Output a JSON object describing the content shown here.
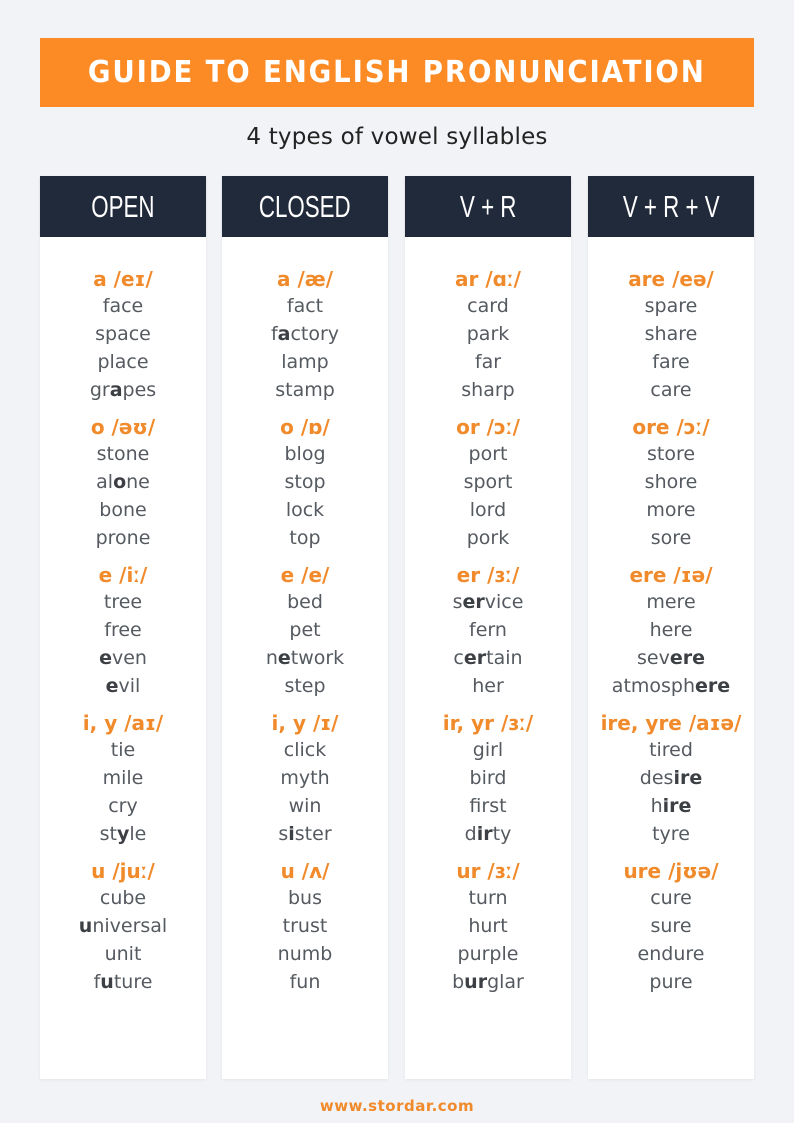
{
  "title": "GUIDE TO ENGLISH PRONUNCIATION",
  "subtitle": "4 types of vowel syllables",
  "footer": "www.stordar.com",
  "colors": {
    "accent": "#fd8b25",
    "header_bg": "#212a3b",
    "text": "#555a60"
  },
  "columns": [
    {
      "header": "OPEN",
      "groups": [
        {
          "title": "a /eɪ/",
          "words": [
            {
              "pre": "face",
              "bold": "",
              "post": ""
            },
            {
              "pre": "space",
              "bold": "",
              "post": ""
            },
            {
              "pre": "place",
              "bold": "",
              "post": ""
            },
            {
              "pre": "gr",
              "bold": "a",
              "post": "pes"
            }
          ]
        },
        {
          "title": "o /əʊ/",
          "words": [
            {
              "pre": "stone",
              "bold": "",
              "post": ""
            },
            {
              "pre": "al",
              "bold": "o",
              "post": "ne"
            },
            {
              "pre": "bone",
              "bold": "",
              "post": ""
            },
            {
              "pre": "prone",
              "bold": "",
              "post": ""
            }
          ]
        },
        {
          "title": "e /iː/",
          "words": [
            {
              "pre": "tree",
              "bold": "",
              "post": ""
            },
            {
              "pre": "free",
              "bold": "",
              "post": ""
            },
            {
              "pre": "",
              "bold": "e",
              "post": "ven"
            },
            {
              "pre": "",
              "bold": "e",
              "post": "vil"
            }
          ]
        },
        {
          "title": "i, y /aɪ/",
          "words": [
            {
              "pre": "tie",
              "bold": "",
              "post": ""
            },
            {
              "pre": "mile",
              "bold": "",
              "post": ""
            },
            {
              "pre": "cry",
              "bold": "",
              "post": ""
            },
            {
              "pre": "st",
              "bold": "y",
              "post": "le"
            }
          ]
        },
        {
          "title": "u /juː/",
          "words": [
            {
              "pre": "cube",
              "bold": "",
              "post": ""
            },
            {
              "pre": "",
              "bold": "u",
              "post": "niversal"
            },
            {
              "pre": "unit",
              "bold": "",
              "post": ""
            },
            {
              "pre": "f",
              "bold": "u",
              "post": "ture"
            }
          ]
        }
      ]
    },
    {
      "header": "CLOSED",
      "groups": [
        {
          "title": "a /æ/",
          "words": [
            {
              "pre": "fact",
              "bold": "",
              "post": ""
            },
            {
              "pre": "f",
              "bold": "a",
              "post": "ctory"
            },
            {
              "pre": "lamp",
              "bold": "",
              "post": ""
            },
            {
              "pre": "stamp",
              "bold": "",
              "post": ""
            }
          ]
        },
        {
          "title": "o /ɒ/",
          "words": [
            {
              "pre": "blog",
              "bold": "",
              "post": ""
            },
            {
              "pre": "stop",
              "bold": "",
              "post": ""
            },
            {
              "pre": "lock",
              "bold": "",
              "post": ""
            },
            {
              "pre": "top",
              "bold": "",
              "post": ""
            }
          ]
        },
        {
          "title": "e /e/",
          "words": [
            {
              "pre": "bed",
              "bold": "",
              "post": ""
            },
            {
              "pre": "pet",
              "bold": "",
              "post": ""
            },
            {
              "pre": "n",
              "bold": "e",
              "post": "twork"
            },
            {
              "pre": "step",
              "bold": "",
              "post": ""
            }
          ]
        },
        {
          "title": "i, y /ɪ/",
          "words": [
            {
              "pre": "click",
              "bold": "",
              "post": ""
            },
            {
              "pre": "myth",
              "bold": "",
              "post": ""
            },
            {
              "pre": "win",
              "bold": "",
              "post": ""
            },
            {
              "pre": "s",
              "bold": "i",
              "post": "ster"
            }
          ]
        },
        {
          "title": "u /ʌ/",
          "words": [
            {
              "pre": "bus",
              "bold": "",
              "post": ""
            },
            {
              "pre": "trust",
              "bold": "",
              "post": ""
            },
            {
              "pre": "numb",
              "bold": "",
              "post": ""
            },
            {
              "pre": "fun",
              "bold": "",
              "post": ""
            }
          ]
        }
      ]
    },
    {
      "header": "V + R",
      "groups": [
        {
          "title": "ar /ɑː/",
          "words": [
            {
              "pre": "card",
              "bold": "",
              "post": ""
            },
            {
              "pre": "park",
              "bold": "",
              "post": ""
            },
            {
              "pre": "far",
              "bold": "",
              "post": ""
            },
            {
              "pre": "sharp",
              "bold": "",
              "post": ""
            }
          ]
        },
        {
          "title": "or /ɔː/",
          "words": [
            {
              "pre": "port",
              "bold": "",
              "post": ""
            },
            {
              "pre": "sport",
              "bold": "",
              "post": ""
            },
            {
              "pre": "lord",
              "bold": "",
              "post": ""
            },
            {
              "pre": "pork",
              "bold": "",
              "post": ""
            }
          ]
        },
        {
          "title": "er /ɜː/",
          "words": [
            {
              "pre": "s",
              "bold": "er",
              "post": "vice"
            },
            {
              "pre": "fern",
              "bold": "",
              "post": ""
            },
            {
              "pre": "c",
              "bold": "er",
              "post": "tain"
            },
            {
              "pre": "her",
              "bold": "",
              "post": ""
            }
          ]
        },
        {
          "title": "ir, yr /ɜː/",
          "words": [
            {
              "pre": "girl",
              "bold": "",
              "post": ""
            },
            {
              "pre": "bird",
              "bold": "",
              "post": ""
            },
            {
              "pre": "first",
              "bold": "",
              "post": ""
            },
            {
              "pre": "d",
              "bold": "ir",
              "post": "ty"
            }
          ]
        },
        {
          "title": "ur /ɜː/",
          "words": [
            {
              "pre": "turn",
              "bold": "",
              "post": ""
            },
            {
              "pre": "hurt",
              "bold": "",
              "post": ""
            },
            {
              "pre": "purple",
              "bold": "",
              "post": ""
            },
            {
              "pre": "b",
              "bold": "ur",
              "post": "glar"
            }
          ]
        }
      ]
    },
    {
      "header": "V + R + V",
      "groups": [
        {
          "title": "are /eə/",
          "words": [
            {
              "pre": "spare",
              "bold": "",
              "post": ""
            },
            {
              "pre": "share",
              "bold": "",
              "post": ""
            },
            {
              "pre": "fare",
              "bold": "",
              "post": ""
            },
            {
              "pre": "care",
              "bold": "",
              "post": ""
            }
          ]
        },
        {
          "title": "ore /ɔː/",
          "words": [
            {
              "pre": "store",
              "bold": "",
              "post": ""
            },
            {
              "pre": "shore",
              "bold": "",
              "post": ""
            },
            {
              "pre": "more",
              "bold": "",
              "post": ""
            },
            {
              "pre": "sore",
              "bold": "",
              "post": ""
            }
          ]
        },
        {
          "title": "ere /ɪə/",
          "words": [
            {
              "pre": "mere",
              "bold": "",
              "post": ""
            },
            {
              "pre": "here",
              "bold": "",
              "post": ""
            },
            {
              "pre": "sev",
              "bold": "ere",
              "post": ""
            },
            {
              "pre": "atmosph",
              "bold": "ere",
              "post": ""
            }
          ]
        },
        {
          "title": "ire, yre /aɪə/",
          "words": [
            {
              "pre": "tired",
              "bold": "",
              "post": ""
            },
            {
              "pre": "des",
              "bold": "ire",
              "post": ""
            },
            {
              "pre": "h",
              "bold": "ire",
              "post": ""
            },
            {
              "pre": "tyre",
              "bold": "",
              "post": ""
            }
          ]
        },
        {
          "title": "ure /jʊə/",
          "words": [
            {
              "pre": "cure",
              "bold": "",
              "post": ""
            },
            {
              "pre": "sure",
              "bold": "",
              "post": ""
            },
            {
              "pre": "endure",
              "bold": "",
              "post": ""
            },
            {
              "pre": "pure",
              "bold": "",
              "post": ""
            }
          ]
        }
      ]
    }
  ]
}
